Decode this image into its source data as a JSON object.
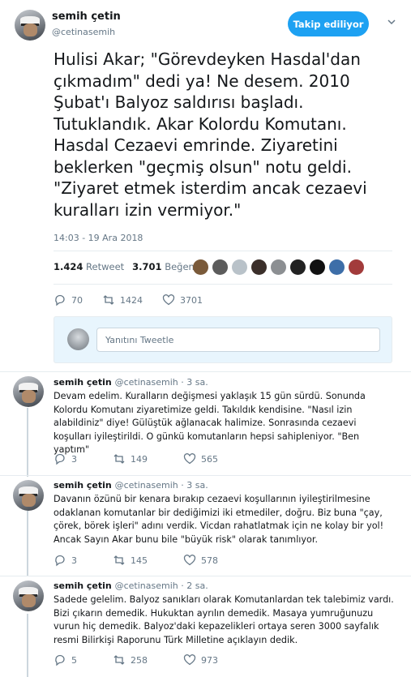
{
  "main": {
    "name": "semih çetin",
    "handle": "@cetinasemih",
    "follow_label": "Takip ediliyor",
    "text": "Hulisi Akar; \"Görevdeyken Hasdal'dan çıkmadım\" dedi ya! Ne desem. 2010 Şubat'ı Balyoz saldırısı başladı. Tutuklandık. Akar Kolordu Komutanı. Hasdal Cezaevi emrinde. Ziyaretini beklerken \"geçmiş olsun\" notu geldi. \"Ziyaret etmek isterdim ancak cezaevi kuralları izin vermiyor.\"",
    "timestamp": "14:03 - 19 Ara 2018",
    "retweet_count": "1.424",
    "retweet_label": "Retweet",
    "like_count": "3.701",
    "like_label": "Beğeni",
    "actions": {
      "reply": "70",
      "retweet": "1424",
      "like": "3701"
    }
  },
  "reply_box": {
    "placeholder": "Yanıtını Tweetle"
  },
  "replies": [
    {
      "name": "semih çetin",
      "meta": "@cetinasemih · 3 sa.",
      "text": "Devam edelim. Kuralların değişmesi yaklaşık 15 gün sürdü. Sonunda Kolordu Komutanı ziyaretimize geldi. Takıldık kendisine. \"Nasıl izin alabildiniz\" diye! Gülüştük ağlanacak halimize. Sonrasında cezaevi koşulları iyileştirildi. O günkü komutanların hepsi sahipleniyor. \"Ben yaptım\"",
      "reply": "3",
      "retweet": "149",
      "like": "565"
    },
    {
      "name": "semih çetin",
      "meta": "@cetinasemih · 3 sa.",
      "text": "Davanın özünü bir kenara bırakıp cezaevi koşullarının iyileştirilmesine odaklanan komutanlar bir dediğimizi iki etmediler, doğru. Biz buna \"çay, çörek, börek işleri\" adını verdik. Vicdan rahatlatmak için ne kolay bir yol! Ancak Sayın Akar bunu bile \"büyük risk\" olarak tanımlıyor.",
      "reply": "3",
      "retweet": "145",
      "like": "578"
    },
    {
      "name": "semih çetin",
      "meta": "@cetinasemih · 2 sa.",
      "text": "Sadede gelelim. Balyoz sanıkları olarak Komutanlardan tek talebimiz vardı. Bizi çıkarın demedik. Hukuktan ayrılın demedik. Masaya yumruğunuzu vurun hiç demedik. Balyoz'daki kepazelikleri ortaya seren 3000 sayfalık resmi Bilirkişi Raporunu Türk Milletine açıklayın dedik.",
      "reply": "5",
      "retweet": "258",
      "like": "973"
    }
  ],
  "colors": {
    "accent": "#1da1f2",
    "muted": "#657786",
    "text": "#14171a",
    "divider": "#e6ecf0"
  }
}
